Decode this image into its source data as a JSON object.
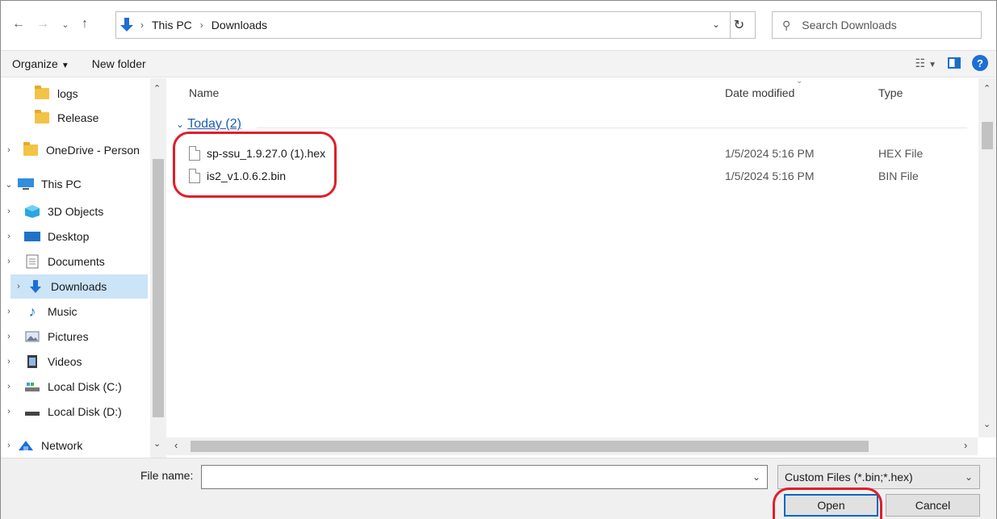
{
  "address_bar": {
    "breadcrumb": [
      "This PC",
      "Downloads"
    ],
    "search_placeholder": "Search Downloads"
  },
  "toolbar": {
    "organize_label": "Organize",
    "new_folder_label": "New folder",
    "help_label": "?"
  },
  "nav_pane": {
    "items": [
      {
        "label": "logs",
        "icon": "folder-icon"
      },
      {
        "label": "Release",
        "icon": "folder-icon"
      },
      {
        "label": "OneDrive - Person",
        "icon": "folder-icon"
      },
      {
        "label": "This PC",
        "icon": "computer-icon"
      },
      {
        "label": "3D Objects",
        "icon": "3d-objects-icon"
      },
      {
        "label": "Desktop",
        "icon": "desktop-icon"
      },
      {
        "label": "Documents",
        "icon": "documents-icon"
      },
      {
        "label": "Downloads",
        "icon": "downloads-icon"
      },
      {
        "label": "Music",
        "icon": "music-icon"
      },
      {
        "label": "Pictures",
        "icon": "pictures-icon"
      },
      {
        "label": "Videos",
        "icon": "videos-icon"
      },
      {
        "label": "Local Disk (C:)",
        "icon": "local-disk-icon"
      },
      {
        "label": "Local Disk (D:)",
        "icon": "local-disk-icon"
      },
      {
        "label": "Network",
        "icon": "network-icon"
      }
    ],
    "selected": "Downloads"
  },
  "file_list": {
    "columns": [
      "Name",
      "Date modified",
      "Type"
    ],
    "group_label": "Today (2)",
    "files": [
      {
        "name": "sp-ssu_1.9.27.0 (1).hex",
        "date": "1/5/2024 5:16 PM",
        "type": "HEX File"
      },
      {
        "name": "is2_v1.0.6.2.bin",
        "date": "1/5/2024 5:16 PM",
        "type": "BIN File"
      }
    ]
  },
  "bottom": {
    "file_name_label": "File name:",
    "file_name_value": "",
    "filter_value": "Custom Files (*.bin;*.hex)",
    "open_label": "Open",
    "cancel_label": "Cancel"
  },
  "colors": {
    "accent": "#0067c0",
    "selection": "#cce4f7",
    "highlight": "#e01e2b"
  }
}
